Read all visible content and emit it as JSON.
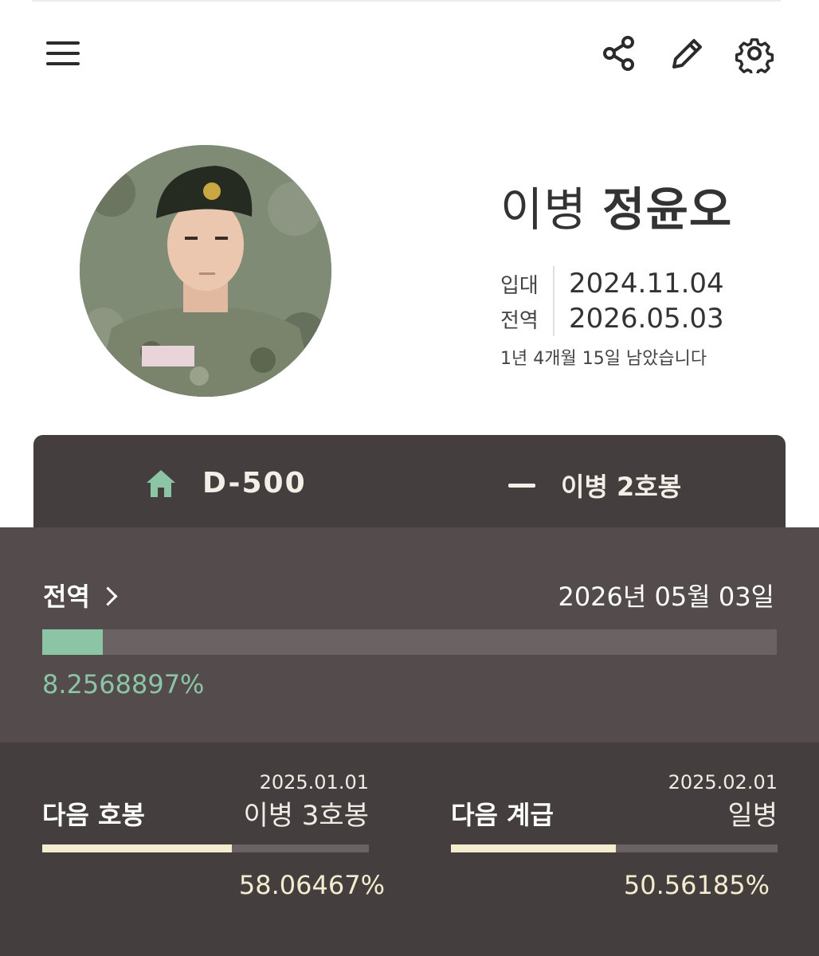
{
  "toolbar": {
    "menu_icon": "hamburger-menu-icon",
    "share_icon": "share-icon",
    "edit_icon": "pencil-icon",
    "settings_icon": "gear-icon"
  },
  "profile": {
    "rank": "이병",
    "name": "정윤오",
    "enlist_label": "입대",
    "enlist_date": "2024.11.04",
    "discharge_label": "전역",
    "discharge_date": "2026.05.03",
    "remaining": "1년 4개월 15일 남았습니다"
  },
  "tabs": {
    "dday": "D-500",
    "dday_icon": "home-icon",
    "grade": "이병 2호봉"
  },
  "discharge": {
    "title": "전역",
    "date": "2026년 05월 03일",
    "percent_text": "8.2568897%",
    "progress": 0.082568897
  },
  "next_step": {
    "title": "다음 호봉",
    "date": "2025.01.01",
    "target": "이병 3호봉",
    "percent_text": "58.06467%",
    "progress": 0.5806467
  },
  "next_rank": {
    "title": "다음 계급",
    "date": "2025.02.01",
    "target": "일병",
    "percent_text": "50.56185%",
    "progress": 0.5056185
  },
  "colors": {
    "accent_green": "#8cc4a6",
    "accent_cream": "#f4ecce",
    "dark_panel": "#453e3f",
    "mid_panel": "#534b4c"
  }
}
